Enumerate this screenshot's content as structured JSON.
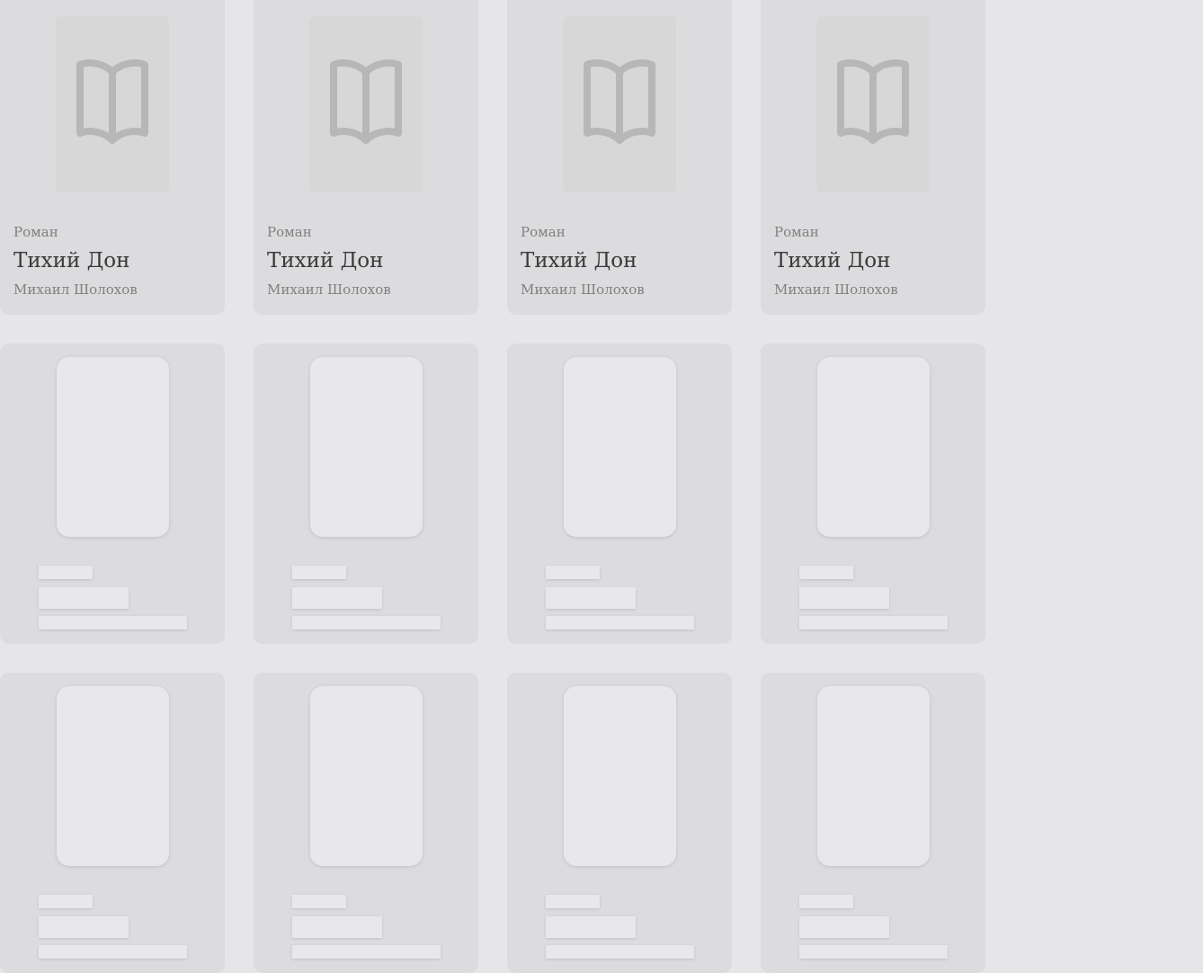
{
  "books": [
    {
      "genre": "Роман",
      "title": "Тихий Дон",
      "author": "Михаил Шолохов",
      "cover_icon": "book-open-icon"
    },
    {
      "genre": "Роман",
      "title": "Тихий Дон",
      "author": "Михаил Шолохов",
      "cover_icon": "book-open-icon"
    },
    {
      "genre": "Роман",
      "title": "Тихий Дон",
      "author": "Михаил Шолохов",
      "cover_icon": "book-open-icon"
    },
    {
      "genre": "Роман",
      "title": "Тихий Дон",
      "author": "Михаил Шолохов",
      "cover_icon": "book-open-icon"
    }
  ],
  "skeleton_rows": 2,
  "colors": {
    "background": "#e6e6e8",
    "card": "#dcdcde",
    "icon": "#b8b7b7",
    "skeleton": "#e8e8ea"
  }
}
